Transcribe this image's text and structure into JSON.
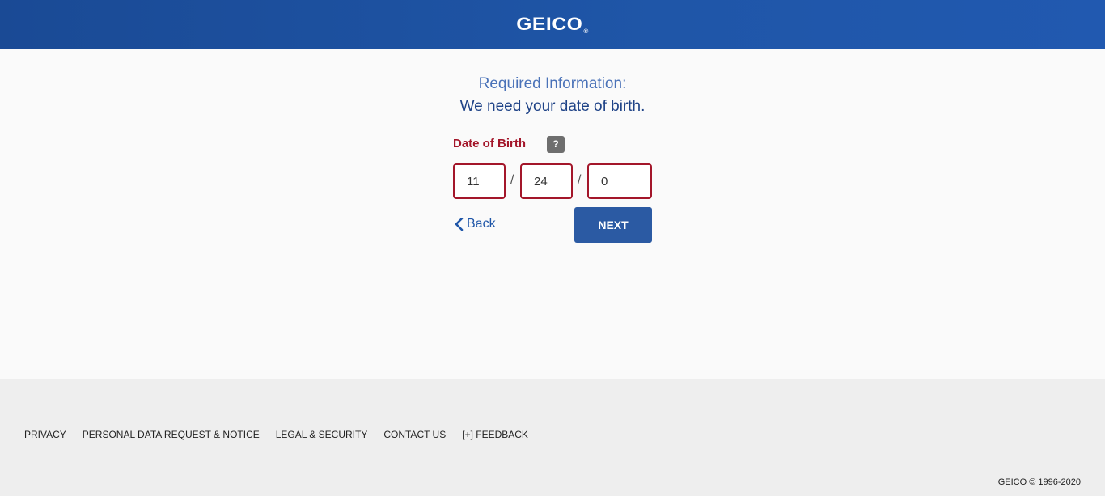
{
  "header": {
    "logo_text": "GEICO",
    "logo_mark": "®",
    "background_color": "#1f56a8"
  },
  "main": {
    "heading_line1": "Required Information:",
    "heading_line2": "We need your date of birth.",
    "dob_label": "Date of Birth",
    "help_label": "?",
    "month_value": "11",
    "day_value": "24",
    "year_value": "0",
    "separator": "/",
    "back_label": "Back",
    "next_label": "NEXT",
    "error_color": "#a3162a",
    "button_color": "#2b5aa3"
  },
  "footer": {
    "links": [
      "PRIVACY",
      "PERSONAL DATA REQUEST & NOTICE",
      "LEGAL & SECURITY",
      "CONTACT US",
      "[+] FEEDBACK"
    ],
    "copyright": "GEICO © 1996-2020"
  }
}
